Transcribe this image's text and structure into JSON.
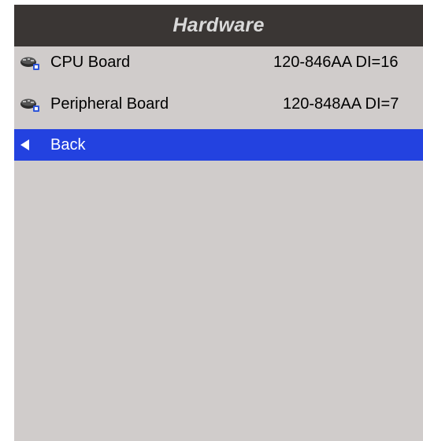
{
  "header": {
    "title": "Hardware"
  },
  "items": [
    {
      "label": "CPU Board",
      "value": "120-846AA DI=16",
      "icon": "circuit-board-icon"
    },
    {
      "label": "Peripheral Board",
      "value": "120-848AA DI=7",
      "icon": "circuit-board-icon"
    }
  ],
  "back": {
    "label": "Back",
    "icon": "back-arrow-icon"
  },
  "colors": {
    "title_bar_bg": "#3a3634",
    "title_text": "#d9d9d9",
    "screen_bg": "#d0cccb",
    "selection_bg": "#2342e0",
    "selection_text": "#ffffff"
  }
}
